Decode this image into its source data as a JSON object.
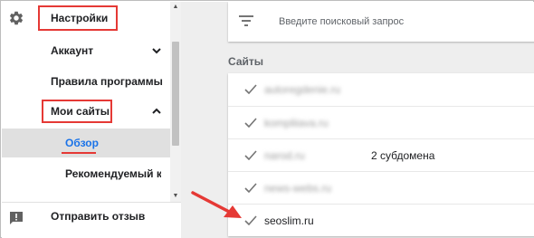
{
  "sidebar": {
    "settings_label": "Настройки",
    "items": [
      {
        "label": "Аккаунт"
      },
      {
        "label": "Правила программы"
      },
      {
        "label": "Мои сайты"
      },
      {
        "label": "Обзор"
      },
      {
        "label": "Рекомендуемый ко..."
      }
    ],
    "feedback_label": "Отправить отзыв"
  },
  "search": {
    "placeholder": "Введите поисковый запрос"
  },
  "sites": {
    "title": "Сайты",
    "rows": [
      {
        "name": "autoregdenie.ru",
        "subdomains": ""
      },
      {
        "name": "kompliiava.ru",
        "subdomains": ""
      },
      {
        "name": "narod.ru",
        "subdomains": "2 субдомена"
      },
      {
        "name": "news-webs.ru",
        "subdomains": ""
      },
      {
        "name": "seoslim.ru",
        "subdomains": ""
      }
    ]
  },
  "colors": {
    "highlight_red": "#e53935",
    "link_blue": "#1a73e8",
    "selected_bg": "#e0e0e0",
    "main_bg": "#eeeeee"
  },
  "icons": {
    "settings": "gear-icon",
    "feedback": "feedback-icon",
    "filter": "filter-icon",
    "check": "check-icon",
    "expand": "chevron-down-icon",
    "collapse": "chevron-up-icon"
  }
}
